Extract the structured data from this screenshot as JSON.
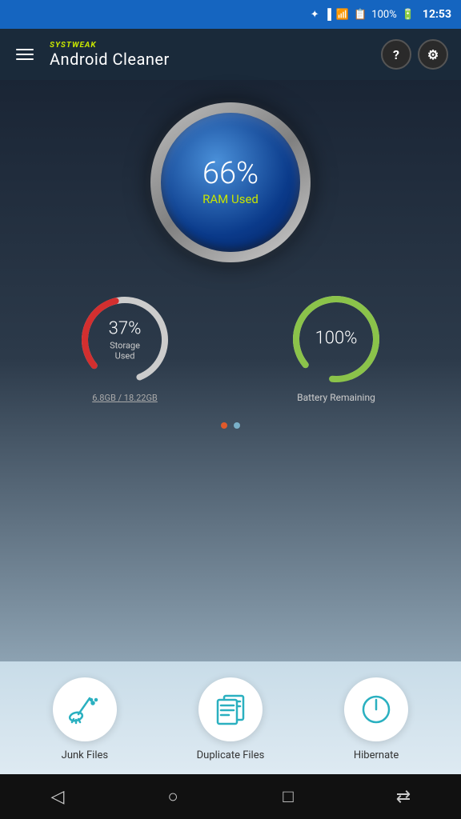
{
  "statusBar": {
    "time": "12:53",
    "battery": "100%"
  },
  "appBar": {
    "brand": "SYS",
    "brandHighlight": "TWEAK",
    "title": "Android Cleaner",
    "helpLabel": "?",
    "settingsLabel": "⚙"
  },
  "ramGauge": {
    "percentage": "66%",
    "label": "RAM Used"
  },
  "storageGauge": {
    "percentage": "37%",
    "label": "Storage Used",
    "detail": "6.8GB / 18.22GB",
    "color": "#d32f2f",
    "trackColor": "#ddd",
    "value": 37
  },
  "batteryGauge": {
    "percentage": "100%",
    "label": "Battery Remaining",
    "color": "#8bc34a",
    "trackColor": "#ddd",
    "value": 100
  },
  "pageDots": [
    {
      "active": true
    },
    {
      "active": false
    }
  ],
  "actions": [
    {
      "label": "Junk Files",
      "icon": "broom"
    },
    {
      "label": "Duplicate Files",
      "icon": "files"
    },
    {
      "label": "Hibernate",
      "icon": "power"
    }
  ],
  "navBar": {
    "back": "◁",
    "home": "○",
    "recents": "□",
    "cast": "⇄"
  }
}
